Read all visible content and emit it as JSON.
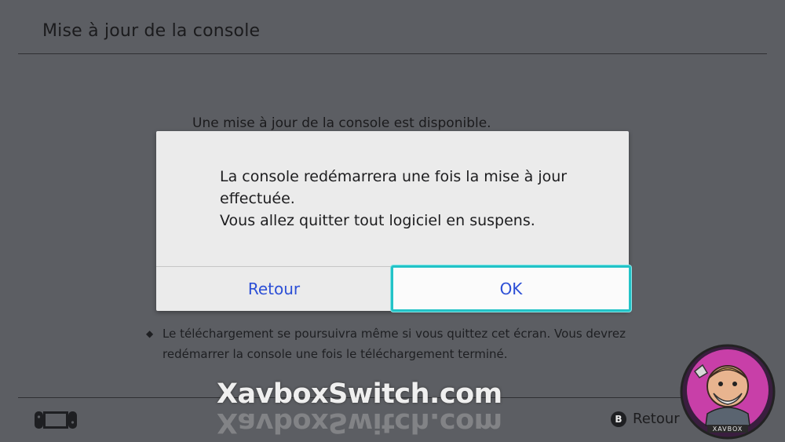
{
  "header": {
    "title": "Mise à jour de la console"
  },
  "background": {
    "headline": "Une mise à jour de la console est disponible.",
    "note_lines": [
      "Le téléchargement se poursuivra même si vous quittez cet écran. Vous devrez",
      "redémarrer la console une fois le téléchargement terminé."
    ]
  },
  "dialog": {
    "message_lines": [
      "La console redémarrera une fois la mise à jour",
      "effectuée.",
      "Vous allez quitter tout logiciel en suspens."
    ],
    "back_label": "Retour",
    "ok_label": "OK"
  },
  "footer": {
    "console_icon": "switch-console-icon",
    "b_button_glyph": "B",
    "b_button_label": "Retour"
  },
  "watermark": {
    "text": "XavboxSwitch.com",
    "logo_text": "XAVBOX"
  },
  "colors": {
    "background": "#5c5e63",
    "dialog": "#ebebeb",
    "button_text": "#2c4fd6",
    "focus_border": "#22c3c7"
  }
}
